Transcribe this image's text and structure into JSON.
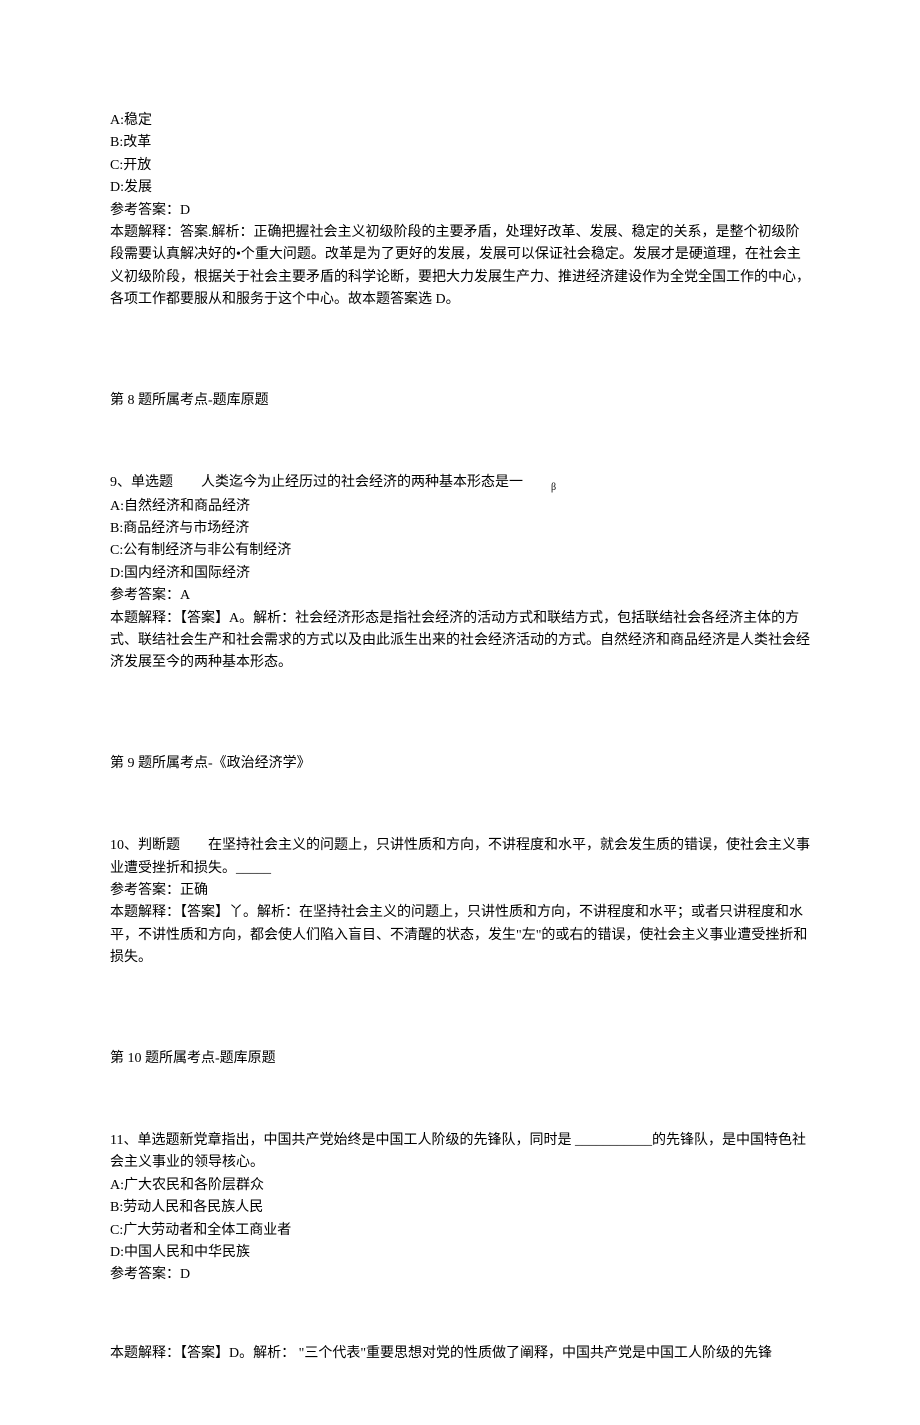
{
  "q8": {
    "opt_a": "A:稳定",
    "opt_b": "B:改革",
    "opt_c": "C:开放",
    "opt_d": "D:发展",
    "answer_label": "参考答案：D",
    "explain": "本题解释：答案.解析：正确把握社会主义初级阶段的主要矛盾，处理好改革、发展、稳定的关系，是整个初级阶段需要认真解决好的•个重大问题。改革是为了更好的发展，发展可以保证社会稳定。发展才是硬道理，在社会主义初级阶段，根据关于社会主要矛盾的科学论断，要把大力发展生产力、推进经济建设作为全党全国工作的中心，各项工作都要服从和服务于这个中心。故本题答案选 D。",
    "topic": "第 8 题所属考点-题库原题"
  },
  "q9": {
    "stem_prefix": "9、单选题　　人类迄今为止经历过的社会经济的两种基本形态是一　　",
    "stem_sub": "β",
    "opt_a": "A:自然经济和商品经济",
    "opt_b": "B:商品经济与市场经济",
    "opt_c": "C:公有制经济与非公有制经济",
    "opt_d": "D:国内经济和国际经济",
    "answer_label": "参考答案：A",
    "explain": "本题解释：【答案】A。解析：社会经济形态是指社会经济的活动方式和联结方式，包括联结社会各经济主体的方式、联结社会生产和社会需求的方式以及由此派生出来的社会经济活动的方式。自然经济和商品经济是人类社会经济发展至今的两种基本形态。",
    "topic": "第 9 题所属考点-《政治经济学》"
  },
  "q10": {
    "stem": "10、判断题　　在坚持社会主义的问题上，只讲性质和方向，不讲程度和水平，就会发生质的错误，使社会主义事业遭受挫折和损失。_____",
    "answer_label": "参考答案：正确",
    "explain": "本题解释：【答案】丫。解析：在坚持社会主义的问题上，只讲性质和方向，不讲程度和水平；或者只讲程度和水平，不讲性质和方向，都会使人们陷入盲目、不清醒的状态，发生\"左\"的或右的错误，使社会主义事业遭受挫折和损失。",
    "topic": "第 10 题所属考点-题库原题"
  },
  "q11": {
    "stem": "11、单选题新党章指出，中国共产党始终是中国工人阶级的先锋队，同时是 ___________的先锋队，是中国特色社会主义事业的领导核心。",
    "opt_a": "A:广大农民和各阶层群众",
    "opt_b": "B:劳动人民和各民族人民",
    "opt_c": "C:广大劳动者和全体工商业者",
    "opt_d": "D:中国人民和中华民族",
    "answer_label": "参考答案：D",
    "explain": "本题解释：【答案】D。解析： \"三个代表\"重要思想对党的性质做了阐释，中国共产党是中国工人阶级的先锋"
  }
}
